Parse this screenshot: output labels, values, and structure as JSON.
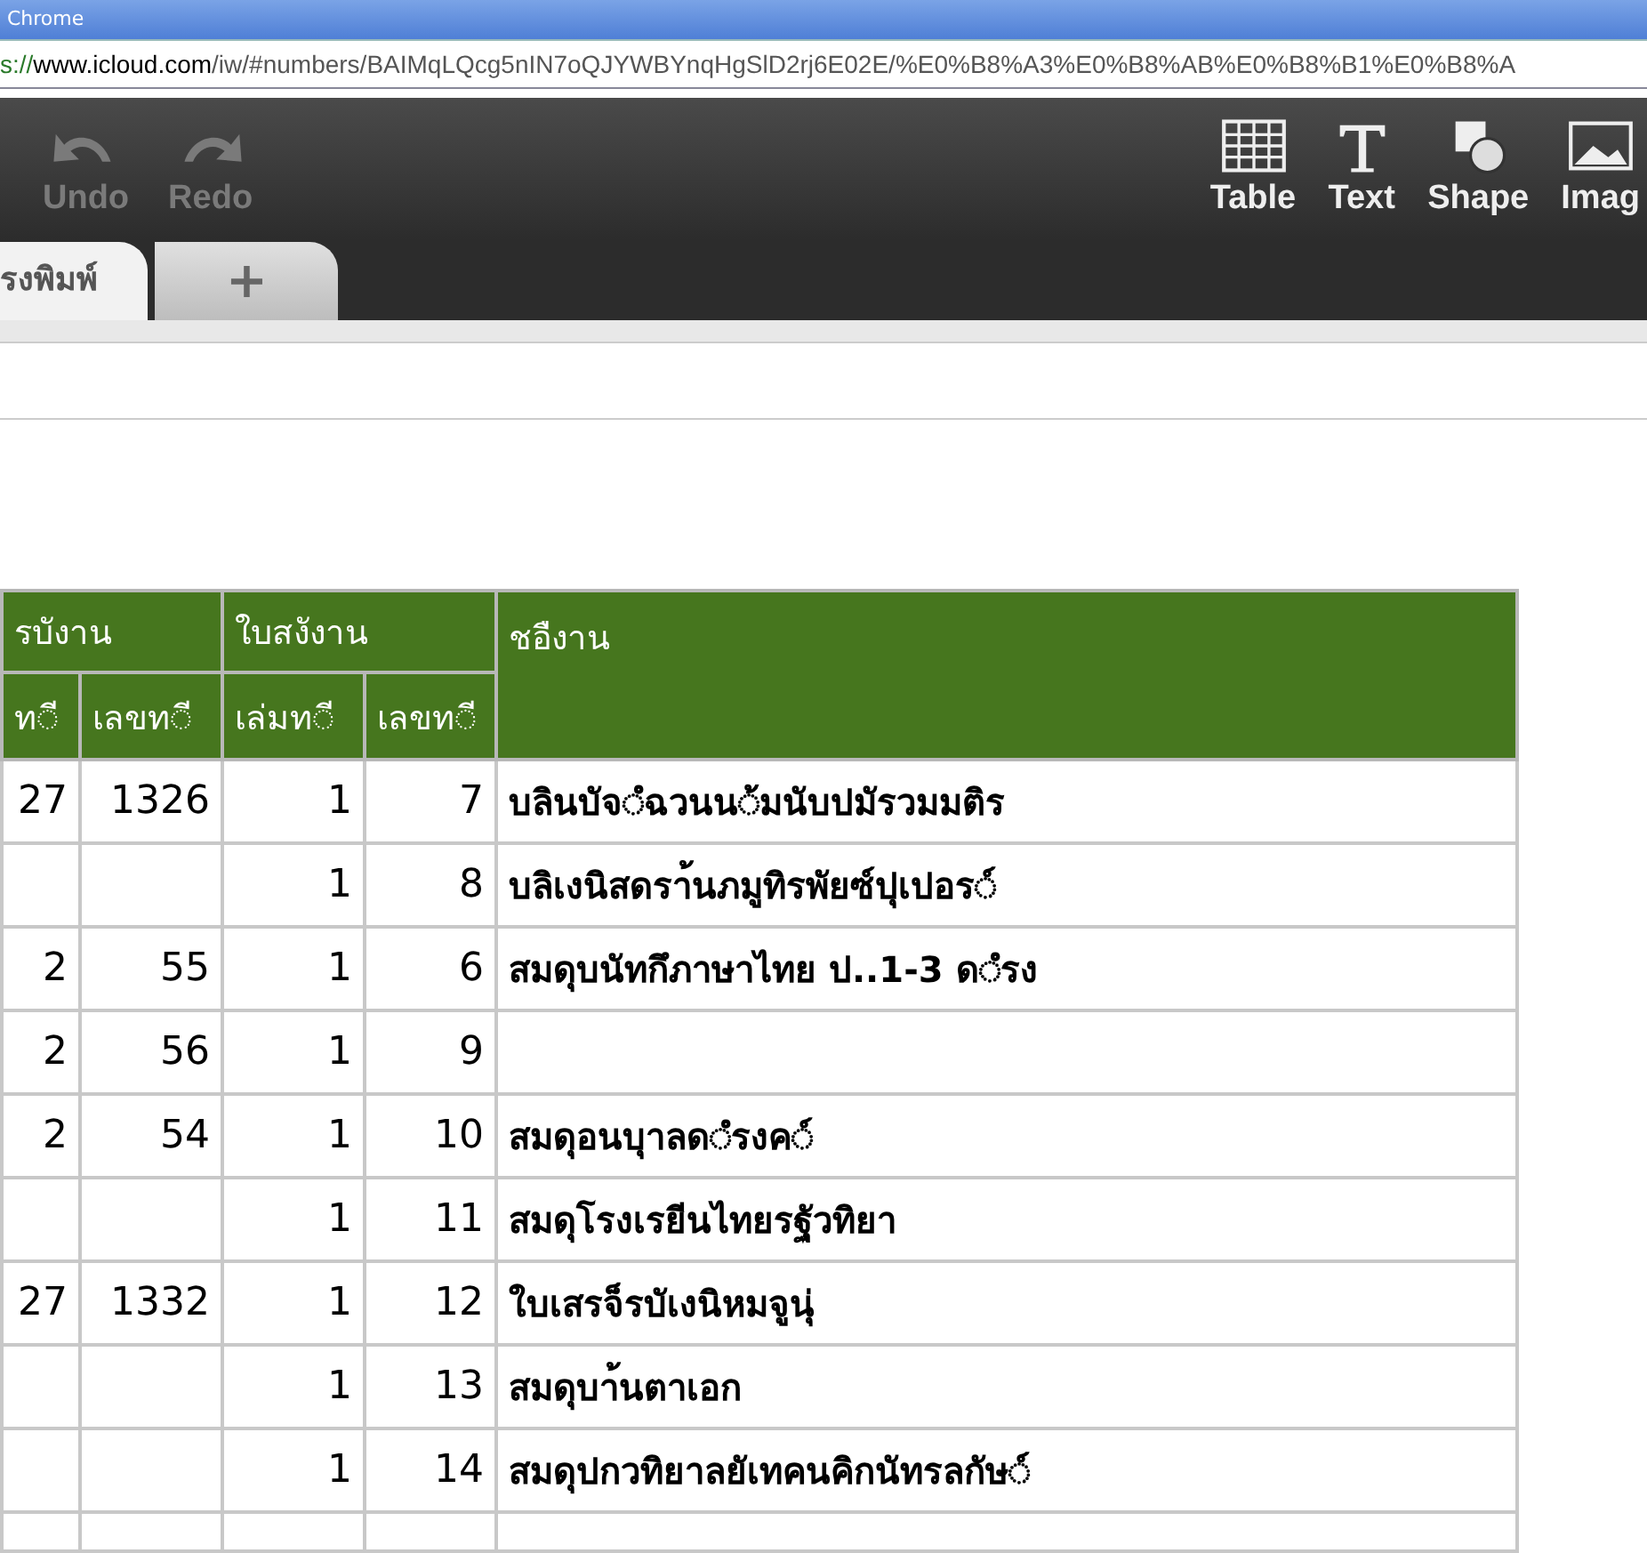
{
  "window": {
    "title": "Chrome"
  },
  "address_bar": {
    "url_prefix": "s://",
    "url_host": "www.icloud.com",
    "url_path": "/iw/#numbers/BAIMqLQcg5nIN7oQJYWBYnqHgSlD2rj6E02E/%E0%B8%A3%E0%B8%AB%E0%B8%B1%E0%B8%A"
  },
  "toolbar": {
    "left": [
      {
        "kind": "undo",
        "label": "Undo",
        "disabled": true
      },
      {
        "kind": "redo",
        "label": "Redo",
        "disabled": true
      }
    ],
    "right": [
      {
        "kind": "table",
        "label": "Table"
      },
      {
        "kind": "text",
        "label": "Text"
      },
      {
        "kind": "shape",
        "label": "Shape"
      },
      {
        "kind": "image",
        "label": "Imag"
      }
    ]
  },
  "sheet_tabs": [
    {
      "label": "รงพิมพ์",
      "selected": true
    },
    {
      "label": "+",
      "selected": false
    }
  ],
  "table": {
    "header_groups": [
      {
        "label": "รบังาน"
      },
      {
        "label": "ใบสงังาน"
      },
      {
        "label": "ชอืงาน"
      }
    ],
    "columns": [
      "ท◌ี",
      "เลขท◌ี",
      "เล่มท◌ี",
      "เลขท◌ี"
    ],
    "rows": [
      [
        "27",
        "1326",
        "1",
        "7",
        "บลินบัจ◌ํฉวนน◌้มนับปมัรวมมติร"
      ],
      [
        "",
        "",
        "1",
        "8",
        "บลิเงนิสดรา้นภมูทิรพัยซ์ปุเปอร◌์"
      ],
      [
        "2",
        "55",
        "1",
        "6",
        "สมดุบนัทกึภาษาไทย ป..1-3 ด◌ํรง"
      ],
      [
        "2",
        "56",
        "1",
        "9",
        ""
      ],
      [
        "2",
        "54",
        "1",
        "10",
        "สมดุอนบุาลด◌ํรงค◌์"
      ],
      [
        "",
        "",
        "1",
        "11",
        "สมดุโรงเรยีนไทยรฐัวทิยา"
      ],
      [
        "27",
        "1332",
        "1",
        "12",
        "ใบเสรจ็รบัเงนิหมจูนุ่"
      ],
      [
        "",
        "",
        "1",
        "13",
        "สมดุบา้นตาเอก"
      ],
      [
        "",
        "",
        "1",
        "14",
        "สมดุปกวทิยาลยัเทคนคิกนัทรลกัษ◌์"
      ]
    ]
  }
}
